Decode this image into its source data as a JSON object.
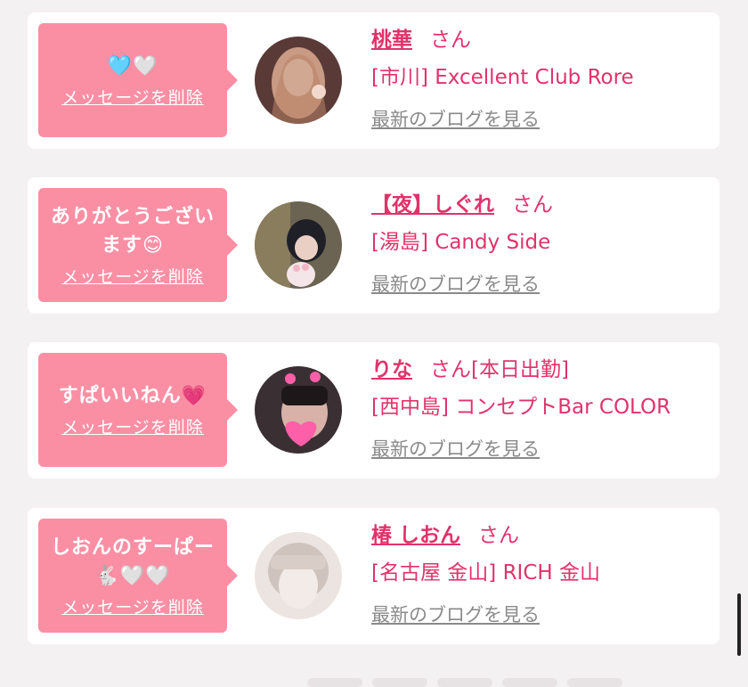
{
  "favorites": [
    {
      "message": "🩵🤍",
      "delete_label": "メッセージを削除",
      "name": "桃華",
      "honorific": "さん",
      "shop": "[市川] Excellent Club Rore",
      "blog_link": "最新のブログを見る",
      "avatar_colors": [
        "#c9a089",
        "#6b4a40"
      ]
    },
    {
      "message": "ありがとうございます😊",
      "delete_label": "メッセージを削除",
      "name": "【夜】しぐれ",
      "honorific": "さん",
      "shop": "[湯島] Candy Side",
      "blog_link": "最新のブログを見る",
      "avatar_colors": [
        "#6f6a58",
        "#23232b"
      ]
    },
    {
      "message": "すぱいいねん💗",
      "delete_label": "メッセージを削除",
      "name": "りな",
      "honorific": "さん[本日出勤]",
      "shop": "[西中島] コンセプトBar COLOR",
      "blog_link": "最新のブログを見る",
      "avatar_colors": [
        "#b89890",
        "#2a2226"
      ]
    },
    {
      "message": "しおんのすーぱー🐇🤍🤍",
      "delete_label": "メッセージを削除",
      "name": "椿 しおん",
      "honorific": "さん",
      "shop": "[名古屋 金山] RICH 金山",
      "blog_link": "最新のブログを見る",
      "avatar_colors": [
        "#efe6e2",
        "#bfb2ad"
      ]
    }
  ],
  "colors": {
    "accent": "#e0336b",
    "bubble": "#fa8fa4",
    "background": "#f4f1f2",
    "link_gray": "#8a8a8a"
  }
}
